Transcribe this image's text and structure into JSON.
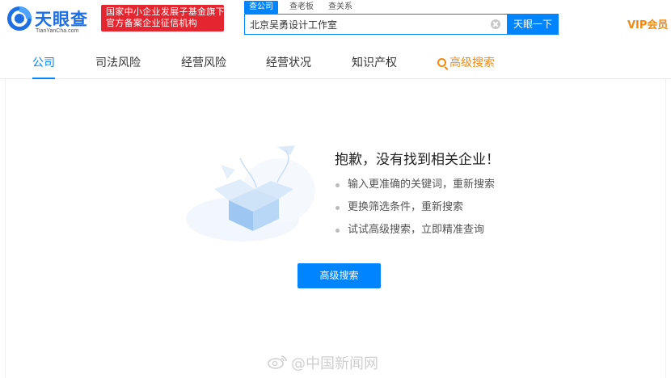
{
  "header": {
    "logo_title": "天眼查",
    "logo_domain": "TianYanCha.com",
    "badge_line1": "国家中小企业发展子基金旗下",
    "badge_line2": "官方备案企业征信机构",
    "search_tabs": [
      "查公司",
      "查老板",
      "查关系"
    ],
    "search_value": "北京吴勇设计工作室",
    "search_button": "天眼一下",
    "vip_label": "VIP会员"
  },
  "nav": {
    "items": [
      "公司",
      "司法风险",
      "经营风险",
      "经营状况",
      "知识产权"
    ],
    "advanced_label": "高级搜索"
  },
  "empty_state": {
    "title": "抱歉，没有找到相关企业！",
    "tips": [
      "输入更准确的关键词，重新搜索",
      "更换筛选条件，重新搜索",
      "试试高级搜索，立即精准查询"
    ],
    "button_label": "高级搜索"
  },
  "watermark": {
    "text": "@中国新闻网"
  },
  "colors": {
    "brand_blue": "#0084ff",
    "logo_blue": "#1d6fe3",
    "badge_red": "#e3262f",
    "vip_orange": "#f08a12"
  }
}
